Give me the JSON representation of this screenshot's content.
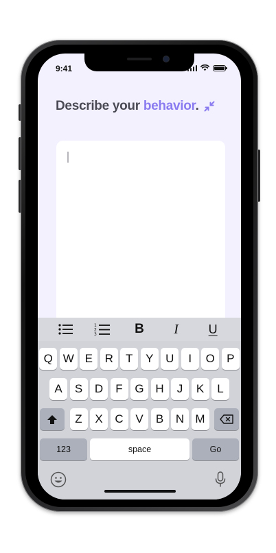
{
  "status_bar": {
    "time": "9:41"
  },
  "heading": {
    "prefix": "Describe your ",
    "accent": "behavior",
    "suffix": "."
  },
  "icons": {
    "collapse": "collapse-arrows-icon",
    "bullet_list": "bulleted-list-icon",
    "numbered_list": "numbered-list-icon",
    "emoji": "emoji-smiley-icon",
    "microphone": "microphone-icon",
    "shift": "shift-arrow-icon",
    "backspace": "backspace-icon"
  },
  "text_area": {
    "value": ""
  },
  "format_bar": {
    "bold_label": "B",
    "italic_label": "I",
    "underline_label": "U"
  },
  "keyboard": {
    "row1": [
      "Q",
      "W",
      "E",
      "R",
      "T",
      "Y",
      "U",
      "I",
      "O",
      "P"
    ],
    "row2": [
      "A",
      "S",
      "D",
      "F",
      "G",
      "H",
      "J",
      "K",
      "L"
    ],
    "row3": [
      "Z",
      "X",
      "C",
      "V",
      "B",
      "N",
      "M"
    ],
    "numbers_label": "123",
    "space_label": "space",
    "go_label": "Go"
  },
  "colors": {
    "accent": "#8a7cf0",
    "heading": "#4a4a55",
    "screen_background": "#f3f1fe",
    "keyboard_background": "#d1d3d9"
  }
}
